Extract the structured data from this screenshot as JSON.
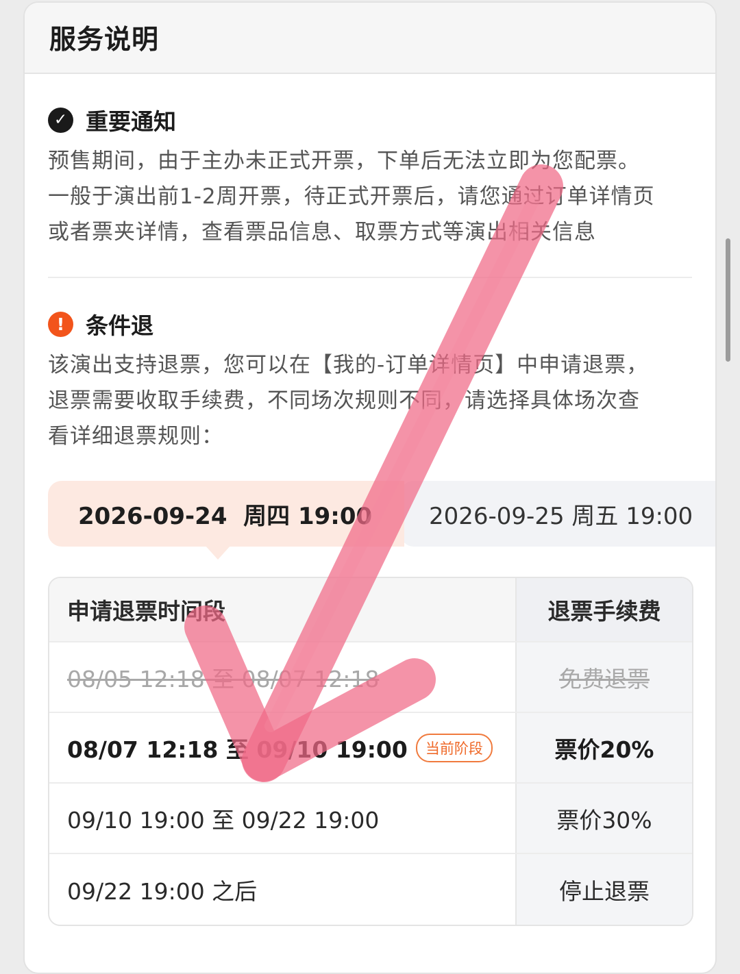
{
  "header": {
    "title": "服务说明"
  },
  "notice": {
    "icon": "check-circle-icon",
    "title": "重要通知",
    "lines": [
      "预售期间，由于主办未正式开票，下单后无法立即为您配票。",
      "一般于演出前1-2周开票，待正式开票后，请您通过订单详情页",
      "或者票夹详情，查看票品信息、取票方式等演出相关信息"
    ]
  },
  "refund": {
    "icon": "warning-circle-icon",
    "title": "条件退",
    "lines": [
      "该演出支持退票，您可以在【我的-订单详情页】中申请退票，",
      "退票需要收取手续费，不同场次规则不同，请选择具体场次查",
      "看详细退票规则："
    ]
  },
  "sessions": [
    {
      "label": "2026-09-24  周四 19:00",
      "selected": true
    },
    {
      "label": "2026-09-25 周五 19:00",
      "selected": false
    }
  ],
  "table": {
    "headers": [
      "申请退票时间段",
      "退票手续费"
    ],
    "rows": [
      {
        "period": "08/05 12:18 至 08/07 12:18",
        "fee": "免费退票",
        "state": "expired"
      },
      {
        "period": "08/07 12:18 至 09/10 19:00",
        "fee": "票价20%",
        "state": "current",
        "badge": "当前阶段"
      },
      {
        "period": "09/10 19:00 至 09/22 19:00",
        "fee": "票价30%",
        "state": "upcoming"
      },
      {
        "period": "09/22 19:00 之后",
        "fee": "停止退票",
        "state": "upcoming"
      }
    ]
  },
  "colors": {
    "accent_orange": "#f2541b",
    "selected_tab": "#fde9e1",
    "checkmark_overlay": "#f06a86"
  }
}
